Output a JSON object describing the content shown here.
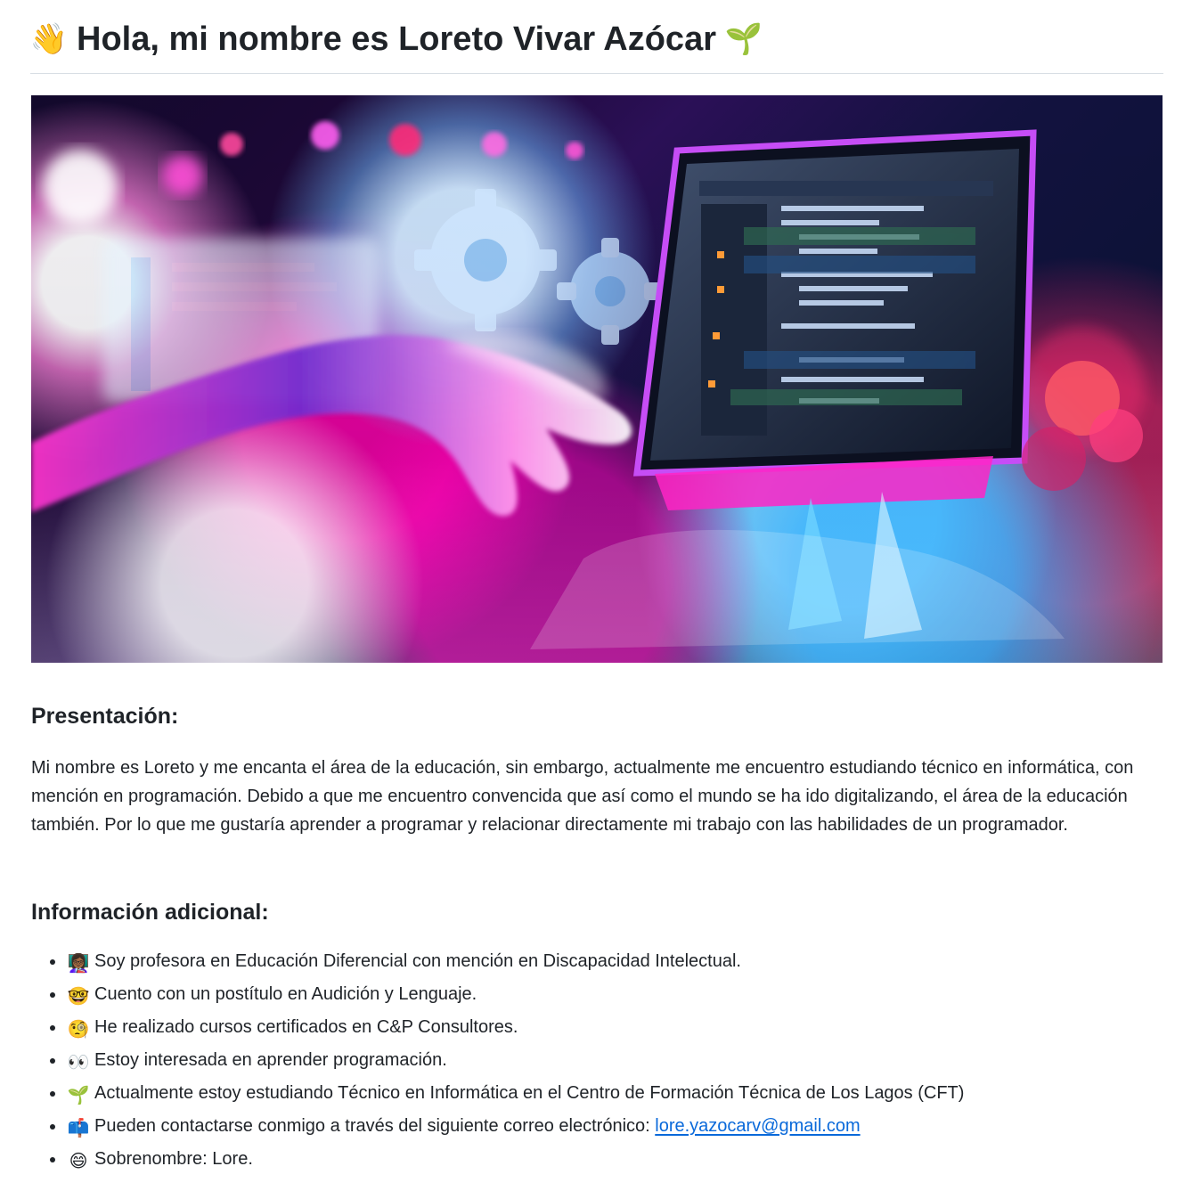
{
  "header": {
    "icon": "waving-hand-icon",
    "icon_glyph": "👋",
    "title": "Hola, mi nombre es Loreto Vivar Azócar",
    "trailing_icon": "seedling-icon",
    "trailing_icon_glyph": "🌱"
  },
  "hero": {
    "type": "banner-image",
    "subject": "hand-interacting-with-laptop-code-and-gears",
    "colors": {
      "magenta": "#ff27c8",
      "cyan": "#57c8ff",
      "navy": "#061231",
      "purple": "#2b1057"
    }
  },
  "sections": {
    "presentacion": {
      "heading": "Presentación:",
      "body": "Mi nombre es Loreto y me encanta el área de la educación, sin embargo, actualmente me encuentro estudiando técnico en informática, con mención en programación. Debido a que me encuentro convencida que así como el mundo se ha ido digitalizando, el área de la educación también. Por lo que me gustaría aprender a programar y relacionar directamente mi trabajo con las habilidades de un programador."
    },
    "informacion": {
      "heading": "Información adicional:",
      "items": [
        {
          "icon": "teacher-icon",
          "icon_glyph": "👩🏾‍🏫",
          "text": "Soy profesora en Educación Diferencial con mención en Discapacidad Intelectual."
        },
        {
          "icon": "nerd-face-icon",
          "icon_glyph": "🤓",
          "text": "Cuento con un postítulo en Audición y Lenguaje."
        },
        {
          "icon": "face-with-monocle-icon",
          "icon_glyph": "🧐",
          "text": "He realizado cursos certificados en C&P Consultores."
        },
        {
          "icon": "eyes-icon",
          "icon_glyph": "👀",
          "text": "Estoy interesada en aprender programación."
        },
        {
          "icon": "seedling-icon",
          "icon_glyph": "🌱",
          "text": "Actualmente estoy estudiando Técnico en Informática en el Centro de Formación Técnica de Los Lagos (CFT)"
        },
        {
          "icon": "mailbox-icon",
          "icon_glyph": "📫",
          "text": "Pueden contactarse conmigo a través del siguiente correo electrónico: ",
          "link_text": "lore.yazocarv@gmail.com"
        },
        {
          "icon": "grinning-face-icon",
          "icon_glyph": "😄",
          "text": "Sobrenombre: Lore."
        }
      ]
    }
  },
  "colors": {
    "text": "#1f2328",
    "link": "#0969da",
    "divider": "#d8dee4",
    "background": "#ffffff"
  }
}
